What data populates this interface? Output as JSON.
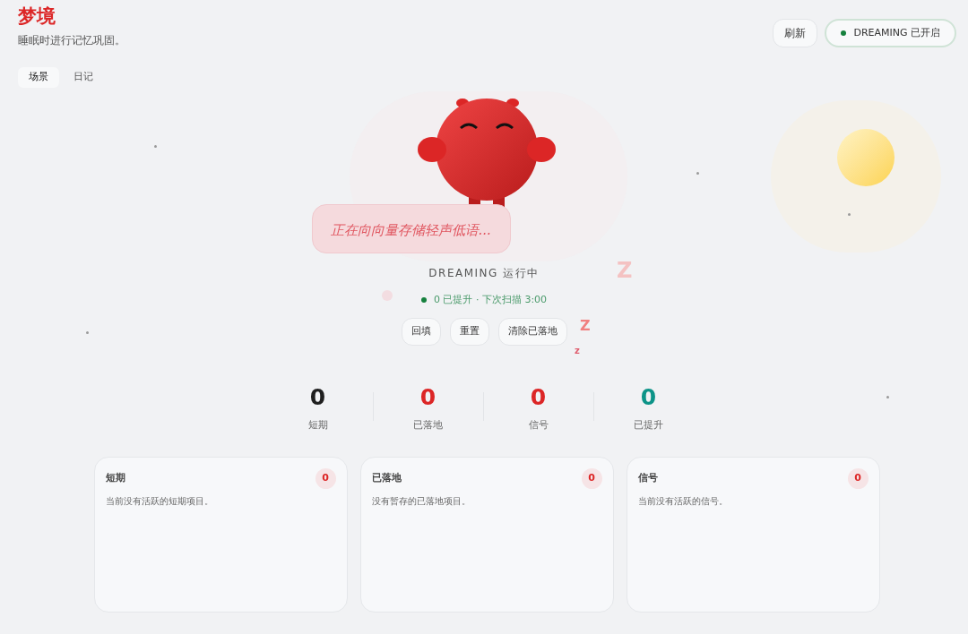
{
  "header": {
    "title": "梦境",
    "subtitle": "睡眠时进行记忆巩固。"
  },
  "header_actions": {
    "refresh": "刷新",
    "status_pill": {
      "label": "DREAMING 已开启",
      "on": true
    }
  },
  "tabs": [
    {
      "label": "场景",
      "selected": true
    },
    {
      "label": "日记",
      "selected": false
    }
  ],
  "scene": {
    "bubble": "正在向向量存储轻声低语...",
    "sleep_marks": [
      "Z",
      "Z",
      "z"
    ],
    "status_title": "DREAMING 运行中",
    "status_line": "0 已提升 · 下次扫描 3:00",
    "status_on": true,
    "actions": [
      "回填",
      "重置",
      "清除已落地"
    ]
  },
  "stats": [
    {
      "value": "0",
      "label": "短期",
      "color": "#1f1f1f"
    },
    {
      "value": "0",
      "label": "已落地",
      "color": "#dc2626"
    },
    {
      "value": "0",
      "label": "信号",
      "color": "#dc2626"
    },
    {
      "value": "0",
      "label": "已提升",
      "color": "#0d9488"
    }
  ],
  "cards": [
    {
      "title": "短期",
      "count": "0",
      "empty_text": "当前没有活跃的短期项目。"
    },
    {
      "title": "已落地",
      "count": "0",
      "empty_text": "没有暂存的已落地项目。"
    },
    {
      "title": "信号",
      "count": "0",
      "empty_text": "当前没有活跃的信号。"
    }
  ]
}
